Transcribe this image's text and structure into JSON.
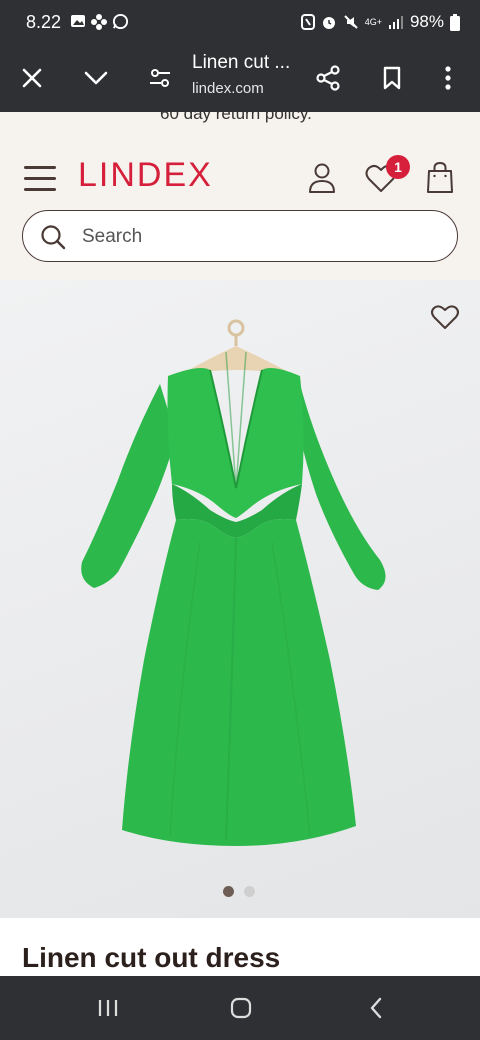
{
  "status_bar": {
    "time": "8.22",
    "network": "4G+",
    "battery": "98%"
  },
  "custom_tab": {
    "title": "Linen cut ...",
    "url": "lindex.com"
  },
  "promo": {
    "text": "60 day return policy."
  },
  "header": {
    "logo": "LINDEX",
    "wishlist_count": "1"
  },
  "search": {
    "placeholder": "Search"
  },
  "product": {
    "title": "Linen cut out dress",
    "image_count": 2,
    "active_image": 1,
    "dress_color": "#2db84b"
  },
  "colors": {
    "brand": "#d6203b",
    "header_bg": "#f6f3ef",
    "dark_brown": "#4a3a36"
  }
}
